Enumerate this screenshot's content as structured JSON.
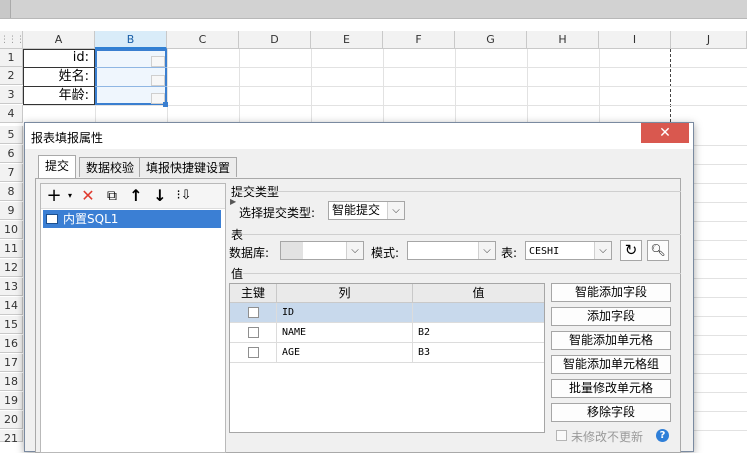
{
  "spreadsheet": {
    "columns": [
      "A",
      "B",
      "C",
      "D",
      "E",
      "F",
      "G",
      "H",
      "I",
      "J"
    ],
    "rows": [
      "1",
      "2",
      "3",
      "4",
      "5",
      "6",
      "7",
      "8",
      "9",
      "10",
      "11",
      "12",
      "13",
      "14",
      "15",
      "16",
      "17",
      "18",
      "19",
      "20",
      "21"
    ],
    "cells": {
      "a1": "id:",
      "a2": "姓名:",
      "a3": "年龄:"
    }
  },
  "dialog": {
    "title": "报表填报属性",
    "close_glyph": "✕",
    "tabs": [
      {
        "label": "提交",
        "active": true
      },
      {
        "label": "数据校验",
        "active": false
      },
      {
        "label": "填报快捷键设置",
        "active": false
      }
    ],
    "toolbar_icons": [
      "add-icon",
      "delete-icon",
      "copy-icon",
      "move-up-icon",
      "move-down-icon",
      "more-icon"
    ],
    "tree": {
      "items": [
        {
          "label": "内置SQL1"
        }
      ]
    },
    "submit_type": {
      "section_label": "提交类型",
      "select_label": "选择提交类型:",
      "value": "智能提交"
    },
    "table_section": {
      "section_label": "表",
      "database_label": "数据库:",
      "database_value": "",
      "mode_label": "模式:",
      "mode_value": "",
      "table_label": "表:",
      "table_value": "CESHI"
    },
    "value_section": {
      "section_label": "值",
      "headers": {
        "key": "主键",
        "column": "列",
        "value": "值"
      },
      "rows": [
        {
          "column": "ID",
          "value": "",
          "selected": true
        },
        {
          "column": "NAME",
          "value": "B2",
          "selected": false
        },
        {
          "column": "AGE",
          "value": "B3",
          "selected": false
        }
      ]
    },
    "buttons": {
      "smart_add_field": "智能添加字段",
      "add_field": "添加字段",
      "smart_add_cell": "智能添加单元格",
      "smart_add_cell_group": "智能添加单元格组",
      "batch_modify_cell": "批量修改单元格",
      "remove_field": "移除字段"
    },
    "unmodified_no_update": "未修改不更新",
    "help_glyph": "?"
  }
}
